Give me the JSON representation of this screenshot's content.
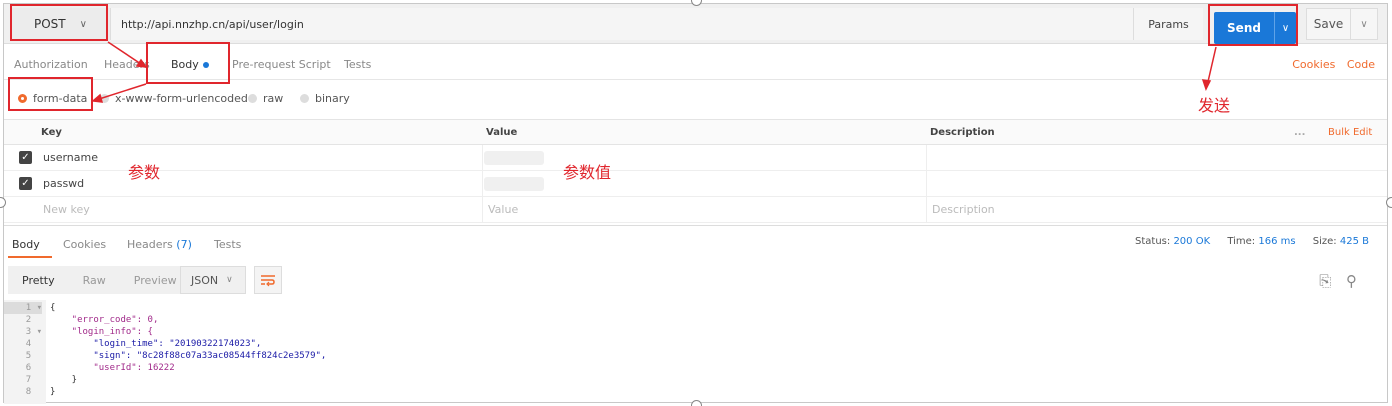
{
  "request": {
    "method": "POST",
    "url": "http://api.nnzhp.cn/api/user/login",
    "params_label": "Params",
    "send_label": "Send",
    "save_label": "Save"
  },
  "request_tabs": [
    "Authorization",
    "Headers",
    "Body",
    "Pre-request Script",
    "Tests"
  ],
  "active_request_tab": "Body",
  "right_links": [
    "Cookies",
    "Code"
  ],
  "body_types": [
    "form-data",
    "x-www-form-urlencoded",
    "raw",
    "binary"
  ],
  "selected_body_type": "form-data",
  "kv_table": {
    "headers": [
      "Key",
      "Value",
      "Description"
    ],
    "more_icon": "...",
    "bulk_edit": "Bulk Edit",
    "rows": [
      {
        "key": "username",
        "checked": true
      },
      {
        "key": "passwd",
        "checked": true
      }
    ],
    "placeholders": {
      "key": "New key",
      "value": "Value",
      "description": "Description"
    }
  },
  "response_tabs": {
    "body": "Body",
    "cookies": "Cookies",
    "headers": "Headers",
    "headers_count": "(7)",
    "tests": "Tests"
  },
  "status": {
    "status_label": "Status:",
    "status_value": "200 OK",
    "time_label": "Time:",
    "time_value": "166 ms",
    "size_label": "Size:",
    "size_value": "425 B"
  },
  "view_modes": [
    "Pretty",
    "Raw",
    "Preview"
  ],
  "active_view_mode": "Pretty",
  "format": "JSON",
  "response_lines": [
    "{",
    "    \"error_code\": 0,",
    "    \"login_info\": {",
    "        \"login_time\": \"20190322174023\",",
    "        \"sign\": \"8c28f88c07a33ac08544ff824c2e3579\",",
    "        \"userId\": 16222",
    "    }",
    "}"
  ],
  "annotations": {
    "send_note": "发送",
    "param_note": "参数",
    "value_note": "参数值"
  },
  "colors": {
    "accent_orange": "#f06a2d",
    "send_blue": "#1a78d8",
    "annotation_red": "#e0262d"
  }
}
